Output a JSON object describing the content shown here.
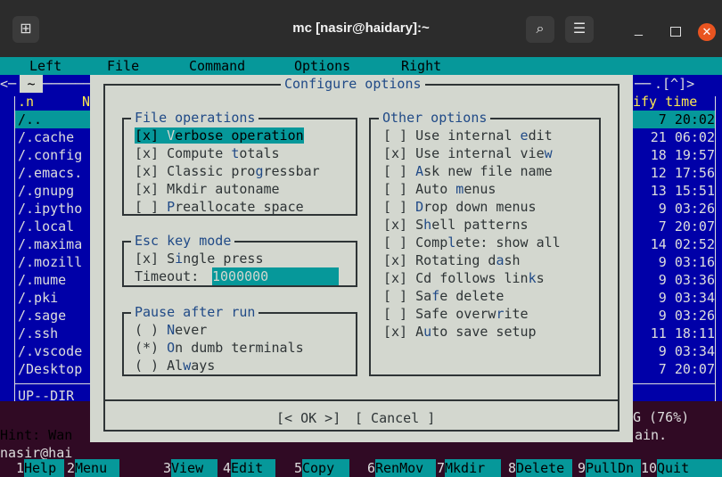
{
  "window": {
    "title": "mc [nasir@haidary]:~"
  },
  "menubar": {
    "items": [
      "Left",
      "File",
      "Command",
      "Options",
      "Right"
    ]
  },
  "left_panel": {
    "path": "~",
    "header_n": ".n",
    "header_name": "N",
    "entries": [
      "/..",
      "/.cache",
      "/.config",
      "/.emacs.",
      "/.gnupg",
      "/.ipytho",
      "/.local",
      "/.maxima",
      "/.mozill",
      "/.mume",
      "/.pki",
      "/.sage",
      "/.ssh",
      "/.vscode",
      "/Desktop"
    ],
    "status": "UP--DIR"
  },
  "right_panel": {
    "corner": ".[^]>",
    "header": "ify time",
    "times": [
      "7 20:02",
      "21 06:02",
      "18 19:57",
      "12 17:56",
      "13 15:51",
      "9 03:26",
      "7 20:07",
      "14 02:52",
      "9 03:16",
      "9 03:36",
      "9 03:34",
      "9 03:26",
      "11 18:11",
      "9 03:34",
      "7 20:07"
    ],
    "status": "G (76%)"
  },
  "hint": {
    "line1_left": "Hint: Wan",
    "line1_right": "ain.",
    "line2": "nasir@hai"
  },
  "dialog": {
    "title": "Configure options",
    "file_operations": {
      "title": "File operations",
      "options": [
        {
          "mark": "[x]",
          "pre": " ",
          "hot": "V",
          "post": "erbose operation"
        },
        {
          "mark": "[x]",
          "pre": " Compute ",
          "hot": "t",
          "post": "otals"
        },
        {
          "mark": "[x]",
          "pre": " Classic pro",
          "hot": "g",
          "post": "ressbar"
        },
        {
          "mark": "[x]",
          "pre": " Mkdir autoname",
          "hot": "",
          "post": ""
        },
        {
          "mark": "[ ]",
          "pre": " ",
          "hot": "P",
          "post": "reallocate space"
        }
      ]
    },
    "esc_key_mode": {
      "title": "Esc key mode",
      "single_press": {
        "mark": "[x]",
        "pre": " S",
        "hot": "i",
        "post": "ngle press"
      },
      "timeout_label": "Timeout:",
      "timeout_value": "1000000"
    },
    "pause_after_run": {
      "title": "Pause after run",
      "options": [
        {
          "mark": "( )",
          "pre": " ",
          "hot": "N",
          "post": "ever"
        },
        {
          "mark": "(*)",
          "pre": " ",
          "hot": "O",
          "post": "n dumb terminals"
        },
        {
          "mark": "( )",
          "pre": " Al",
          "hot": "w",
          "post": "ays"
        }
      ]
    },
    "other_options": {
      "title": "Other options",
      "options": [
        {
          "mark": "[ ]",
          "pre": " Use internal ",
          "hot": "e",
          "post": "dit"
        },
        {
          "mark": "[x]",
          "pre": " Use internal vie",
          "hot": "w",
          "post": ""
        },
        {
          "mark": "[ ]",
          "pre": " ",
          "hot": "A",
          "post": "sk new file name"
        },
        {
          "mark": "[ ]",
          "pre": " Auto ",
          "hot": "m",
          "post": "enus"
        },
        {
          "mark": "[ ]",
          "pre": " ",
          "hot": "D",
          "post": "rop down menus"
        },
        {
          "mark": "[x]",
          "pre": " S",
          "hot": "h",
          "post": "ell patterns"
        },
        {
          "mark": "[ ]",
          "pre": " Comp",
          "hot": "l",
          "post": "ete: show all"
        },
        {
          "mark": "[x]",
          "pre": " Rotating d",
          "hot": "a",
          "post": "sh"
        },
        {
          "mark": "[x]",
          "pre": " Cd follows lin",
          "hot": "k",
          "post": "s"
        },
        {
          "mark": "[ ]",
          "pre": " Sa",
          "hot": "f",
          "post": "e delete"
        },
        {
          "mark": "[ ]",
          "pre": " Safe overw",
          "hot": "r",
          "post": "ite"
        },
        {
          "mark": "[x]",
          "pre": " A",
          "hot": "u",
          "post": "to save setup"
        }
      ]
    },
    "ok_label": "[< OK >]",
    "cancel_label": "[ Cancel ]"
  },
  "fkeys": [
    {
      "num": "1",
      "label": "Help"
    },
    {
      "num": "2",
      "label": "Menu"
    },
    {
      "num": "3",
      "label": "View"
    },
    {
      "num": "4",
      "label": "Edit"
    },
    {
      "num": "5",
      "label": "Copy"
    },
    {
      "num": "6",
      "label": "RenMov"
    },
    {
      "num": "7",
      "label": "Mkdir"
    },
    {
      "num": "8",
      "label": "Delete"
    },
    {
      "num": "9",
      "label": "PullDn"
    },
    {
      "num": "10",
      "label": "Quit"
    }
  ],
  "colors": {
    "terminal_bg": "#300a24",
    "panel_bg": "#0000a8",
    "cyan": "#06989a",
    "dialog_bg": "#d3d7cf",
    "accent_close": "#e95420"
  }
}
